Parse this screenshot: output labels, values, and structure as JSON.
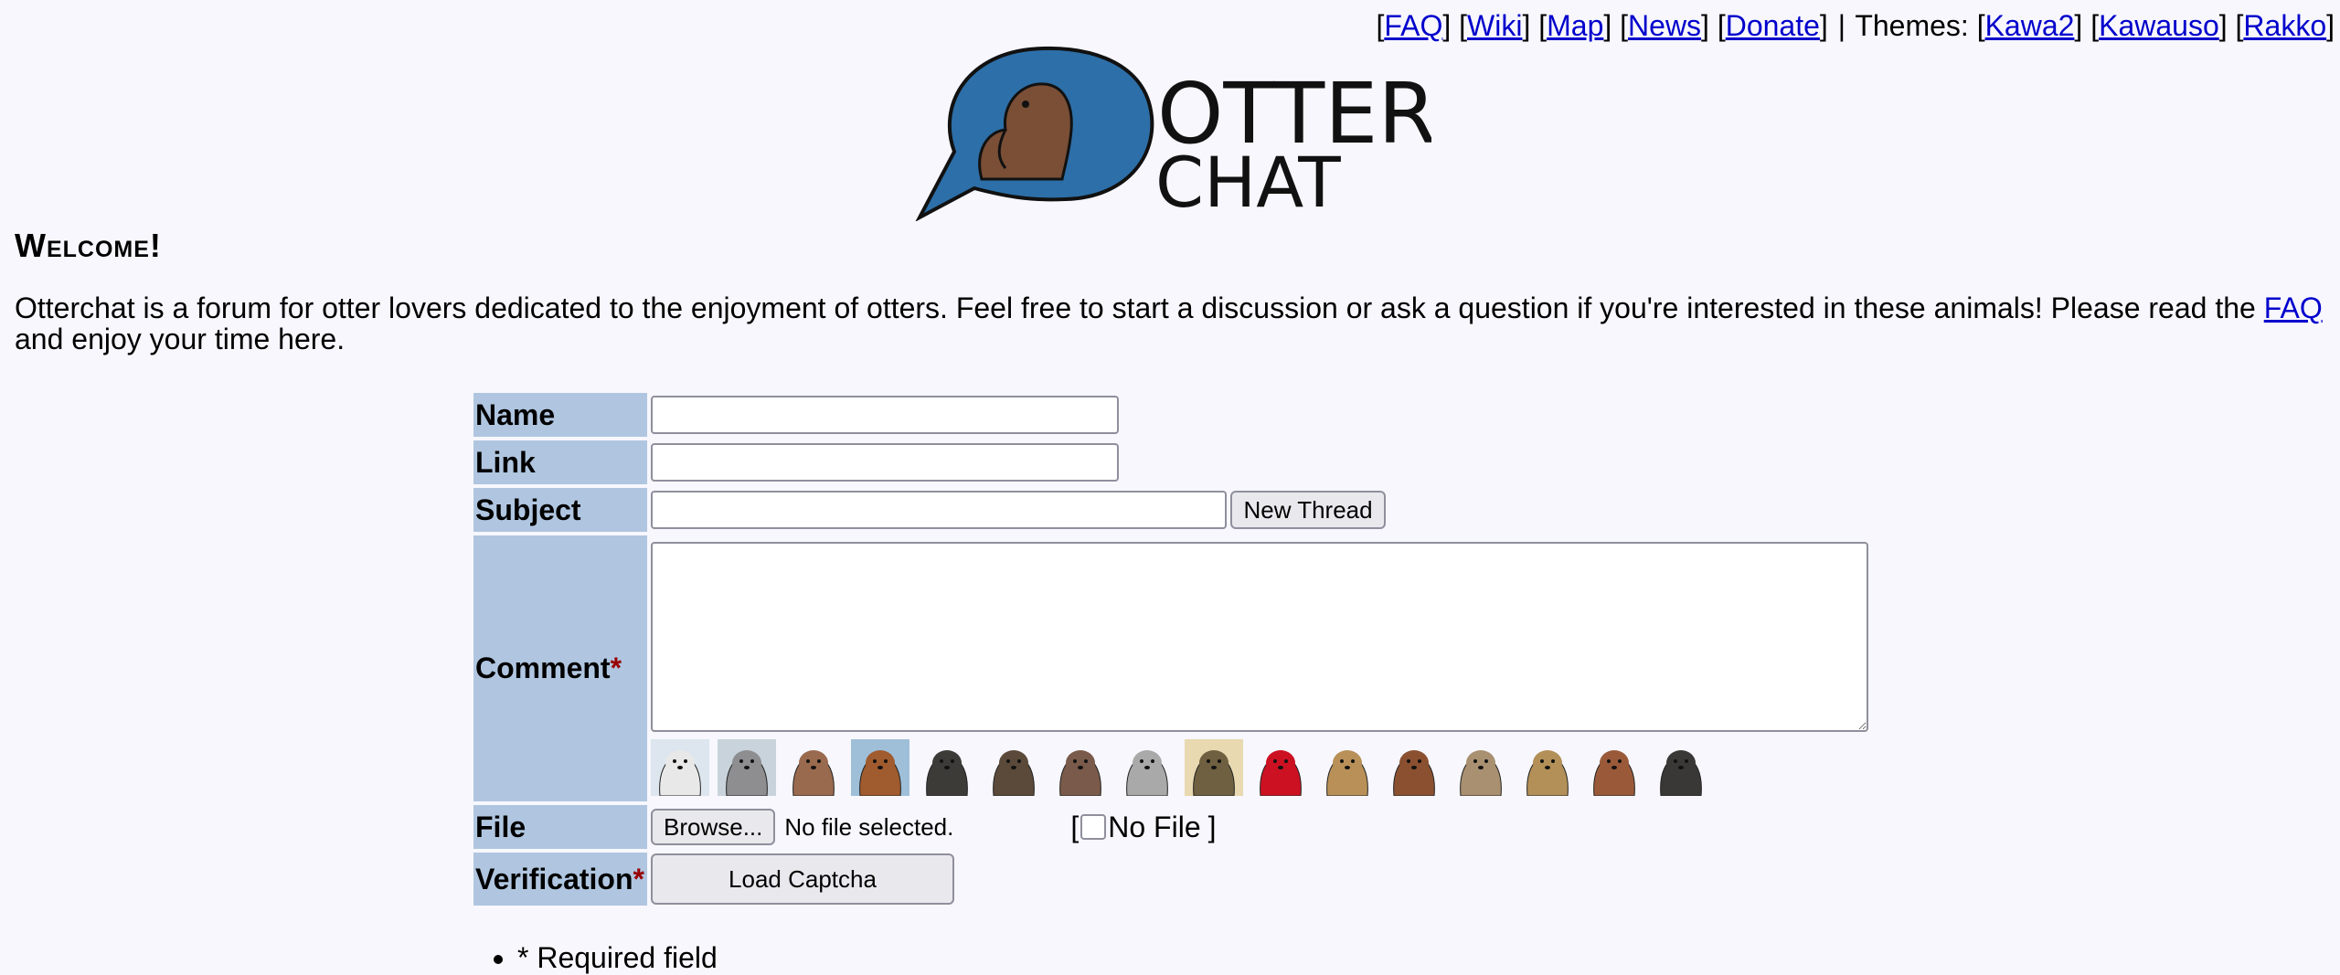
{
  "nav": {
    "links": [
      {
        "label": "FAQ"
      },
      {
        "label": "Wiki"
      },
      {
        "label": "Map"
      },
      {
        "label": "News"
      },
      {
        "label": "Donate"
      }
    ],
    "themes_label": "Themes:",
    "themes": [
      {
        "label": "Kawa2"
      },
      {
        "label": "Kawauso"
      },
      {
        "label": "Rakko"
      }
    ]
  },
  "logo": {
    "line1": "OTTER",
    "line2": "CHAT"
  },
  "welcome": {
    "title": "Welcome!",
    "text_before": "Otterchat is a forum for otter lovers dedicated to the enjoyment of otters. Feel free to start a discussion or ask a question if you're interested in these animals! Please read the ",
    "faq_link": "FAQ",
    "text_after": " and enjoy your time here."
  },
  "form": {
    "name_label": "Name",
    "link_label": "Link",
    "subject_label": "Subject",
    "comment_label": "Comment",
    "required_mark": "*",
    "file_label": "File",
    "verification_label": "Verification",
    "new_thread_button": "New Thread",
    "browse_button": "Browse...",
    "file_status": "No file selected.",
    "no_file_open": "[",
    "no_file_label": "No File",
    "no_file_close": "]",
    "load_captcha_button": "Load Captcha",
    "name_value": "",
    "link_value": "",
    "subject_value": "",
    "comment_value": ""
  },
  "emotes": [
    {
      "icon": "otter-3d-glasses-emote",
      "bg": "#dde6ee",
      "fur": "#e8e8e8"
    },
    {
      "icon": "otter-hood-emote",
      "bg": "#c9d3db",
      "fur": "#8e8e90"
    },
    {
      "icon": "otter-smile-emote",
      "bg": "#f7f7fd",
      "fur": "#9a6a4e"
    },
    {
      "icon": "otter-snow-standing-emote",
      "bg": "#9fbfd8",
      "fur": "#a05b2e"
    },
    {
      "icon": "otter-dark-emote",
      "bg": "#f7f7fd",
      "fur": "#3d3b38"
    },
    {
      "icon": "otter-sketch-emote",
      "bg": "#f7f7fd",
      "fur": "#5b4a3a"
    },
    {
      "icon": "otter-drawn-emote",
      "bg": "#f7f7fd",
      "fur": "#7a5a4a"
    },
    {
      "icon": "otter-grey-emote",
      "bg": "#f7f7fd",
      "fur": "#a9a9a9"
    },
    {
      "icon": "otter-flowers-emote",
      "bg": "#e9d9b0",
      "fur": "#6e6040"
    },
    {
      "icon": "otter-heart-emote",
      "bg": "#f7f7fd",
      "fur": "#cc1122"
    },
    {
      "icon": "otter-cartoon-emote",
      "bg": "#f7f7fd",
      "fur": "#b89058"
    },
    {
      "icon": "otter-brown-emote",
      "bg": "#f7f7fd",
      "fur": "#8a5030"
    },
    {
      "icon": "otter-pyramid-emote",
      "bg": "#f7f7fd",
      "fur": "#a89070"
    },
    {
      "icon": "otter-yellow-emote",
      "bg": "#f7f7fd",
      "fur": "#b39058"
    },
    {
      "icon": "otter-reddish-emote",
      "bg": "#f7f7fd",
      "fur": "#9a5a3a"
    },
    {
      "icon": "otter-screaming-emote",
      "bg": "#f7f7fd",
      "fur": "#3a3836"
    }
  ],
  "notes": [
    "* Required field"
  ],
  "colors": {
    "label_bg": "#b0c6e0",
    "link": "#0000cc",
    "required": "#990000",
    "logo_bubble": "#2d6fa8"
  }
}
